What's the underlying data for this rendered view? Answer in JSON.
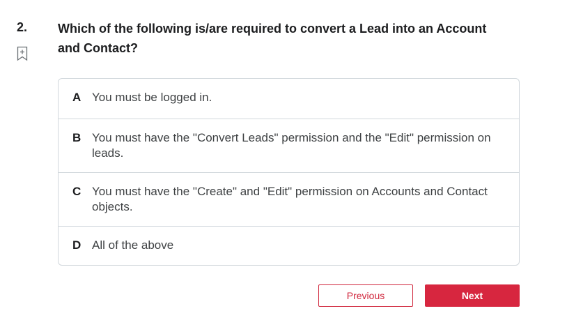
{
  "question": {
    "number": "2.",
    "text": "Which of the following is/are required to convert a Lead into an Account and Contact?",
    "bookmark_icon": "bookmark-plus-icon"
  },
  "options": [
    {
      "letter": "A",
      "text": "You must be logged in."
    },
    {
      "letter": "B",
      "text": "You must have the \"Convert Leads\" permission and the \"Edit\" permission on leads."
    },
    {
      "letter": "C",
      "text": "You must have the \"Create\" and \"Edit\" permission on Accounts and Contact objects."
    },
    {
      "letter": "D",
      "text": "All of the above"
    }
  ],
  "buttons": {
    "previous_label": "Previous",
    "next_label": "Next"
  },
  "colors": {
    "accent": "#d7263f",
    "border": "#d1d7dc",
    "text": "#1c1d1f"
  }
}
